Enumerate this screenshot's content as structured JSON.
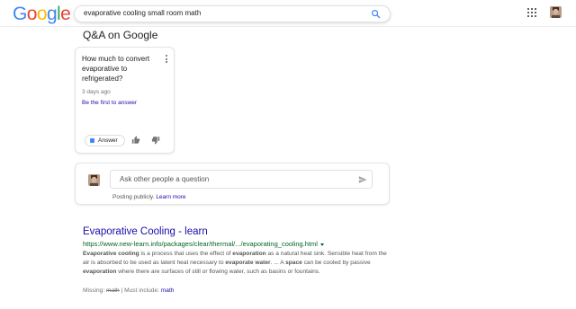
{
  "header": {
    "logo_letters": [
      {
        "ch": "G",
        "color": "#4285F4"
      },
      {
        "ch": "o",
        "color": "#EA4335"
      },
      {
        "ch": "o",
        "color": "#FBBC05"
      },
      {
        "ch": "g",
        "color": "#4285F4"
      },
      {
        "ch": "l",
        "color": "#34A853"
      },
      {
        "ch": "e",
        "color": "#EA4335"
      }
    ],
    "search_query": "evaporative cooling small room math",
    "icons": [
      "search-icon",
      "apps-icon",
      "account-avatar"
    ]
  },
  "qa": {
    "section_title": "Q&A on Google",
    "question": "How much to convert evaporative to refrigerated?",
    "date": "3 days ago",
    "first_answer_link": "Be the first to answer",
    "answer_button": "Answer",
    "ask_placeholder": "Ask other people a question",
    "posting_text": "Posting publicly.",
    "learn_more": "Learn more"
  },
  "result": {
    "title": "Evaporative Cooling - learn",
    "url": "https://www.new-learn.info/packages/clear/thermal/.../evaporating_cooling.html",
    "snippet_parts": [
      {
        "t": "Evaporative cooling",
        "b": true
      },
      {
        "t": " is a process that uses the effect of ",
        "b": false
      },
      {
        "t": "evaporation",
        "b": true
      },
      {
        "t": " as a natural heat sink. Sensible heat from the air is absorbed to be used as latent heat necessary to ",
        "b": false
      },
      {
        "t": "evaporate water",
        "b": true
      },
      {
        "t": ". ... A ",
        "b": false
      },
      {
        "t": "space",
        "b": true
      },
      {
        "t": " can be cooled by passive ",
        "b": false
      },
      {
        "t": "evaporation",
        "b": true
      },
      {
        "t": " where there are surfaces of still or flowing water, such as basins or fountains.",
        "b": false
      }
    ],
    "missing_label": "Missing:",
    "missing_term": "math",
    "must_include_label": "| Must include:",
    "must_include_term": "math"
  },
  "colors": {
    "link": "#1a0dab",
    "url_green": "#006621",
    "accent_blue": "#4285f4"
  }
}
